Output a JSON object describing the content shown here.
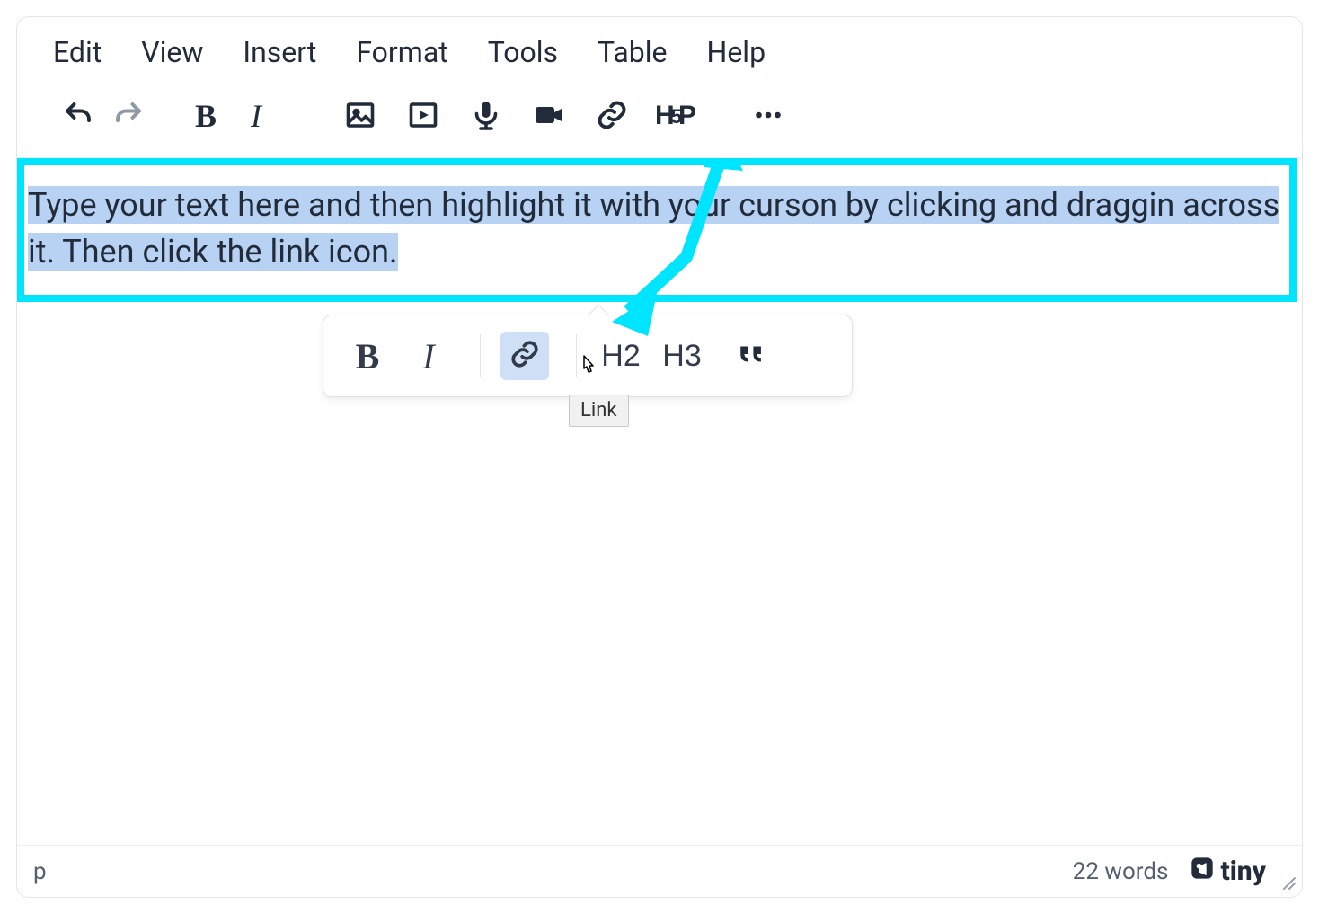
{
  "menubar": {
    "edit": "Edit",
    "view": "View",
    "insert": "Insert",
    "format": "Format",
    "tools": "Tools",
    "table": "Table",
    "help": "Help"
  },
  "toolbar": {
    "undo": "Undo",
    "redo": "Redo",
    "bold": "B",
    "italic": "I",
    "image": "Image",
    "media": "Media",
    "audio": "Audio",
    "video": "Video",
    "link": "Link",
    "h5p_h": "H",
    "h5p_5": "5",
    "h5p_p": "P",
    "more": "More"
  },
  "content": {
    "text_selected": "Type your text here and then highlight it with your curson by clicking and draggin across it. Then click the link icon."
  },
  "quickbar": {
    "bold": "B",
    "italic": "I",
    "link": "Link",
    "h2": "H2",
    "h3": "H3",
    "quote": "❝"
  },
  "tooltip": {
    "link": "Link"
  },
  "footer": {
    "path": "p",
    "word_count": "22 words",
    "brand": "tiny"
  },
  "annotation": {
    "highlight_color": "#00e5ff"
  }
}
